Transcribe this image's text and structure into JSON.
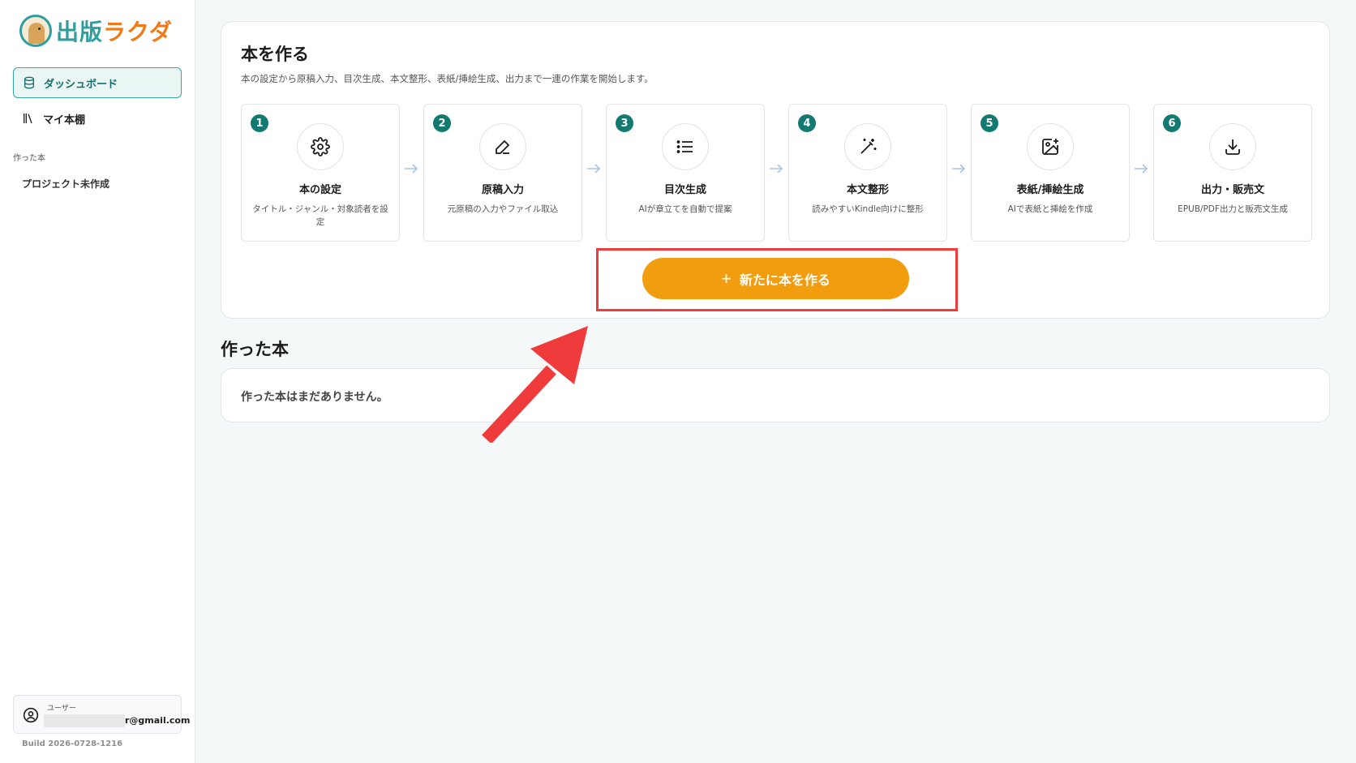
{
  "app": {
    "logo_part1": "出版",
    "logo_part2": "ラクダ"
  },
  "sidebar": {
    "items": [
      {
        "label": "ダッシュボード",
        "icon": "database-icon",
        "active": true
      },
      {
        "label": "マイ本棚",
        "icon": "bookshelf-icon",
        "active": false
      }
    ],
    "section_label": "作った本",
    "project_link": "プロジェクト未作成",
    "user": {
      "role": "ユーザー",
      "email_visible": "r@gmail.com"
    },
    "build": "Build 2026-0728-1216"
  },
  "create": {
    "title": "本を作る",
    "description": "本の設定から原稿入力、目次生成、本文整形、表紙/挿絵生成、出力まで一連の作業を開始します。",
    "steps": [
      {
        "num": "1",
        "icon": "gear-icon",
        "title": "本の設定",
        "desc": "タイトル・ジャンル・対象読者を設定"
      },
      {
        "num": "2",
        "icon": "pencil-icon",
        "title": "原稿入力",
        "desc": "元原稿の入力やファイル取込"
      },
      {
        "num": "3",
        "icon": "list-icon",
        "title": "目次生成",
        "desc": "AIが章立てを自動で提案"
      },
      {
        "num": "4",
        "icon": "magic-wand-icon",
        "title": "本文整形",
        "desc": "読みやすいKindle向けに整形"
      },
      {
        "num": "5",
        "icon": "image-plus-icon",
        "title": "表紙/挿絵生成",
        "desc": "AIで表紙と挿絵を作成"
      },
      {
        "num": "6",
        "icon": "download-icon",
        "title": "出力・販売文",
        "desc": "EPUB/PDF出力と販売文生成"
      }
    ],
    "new_button": {
      "plus": "+",
      "label": "新たに本を作る"
    }
  },
  "made": {
    "title": "作った本",
    "empty_message": "作った本はまだありません。"
  },
  "colors": {
    "accent": "#127a70",
    "button": "#f29d0d",
    "highlight": "#ef3b3b"
  }
}
